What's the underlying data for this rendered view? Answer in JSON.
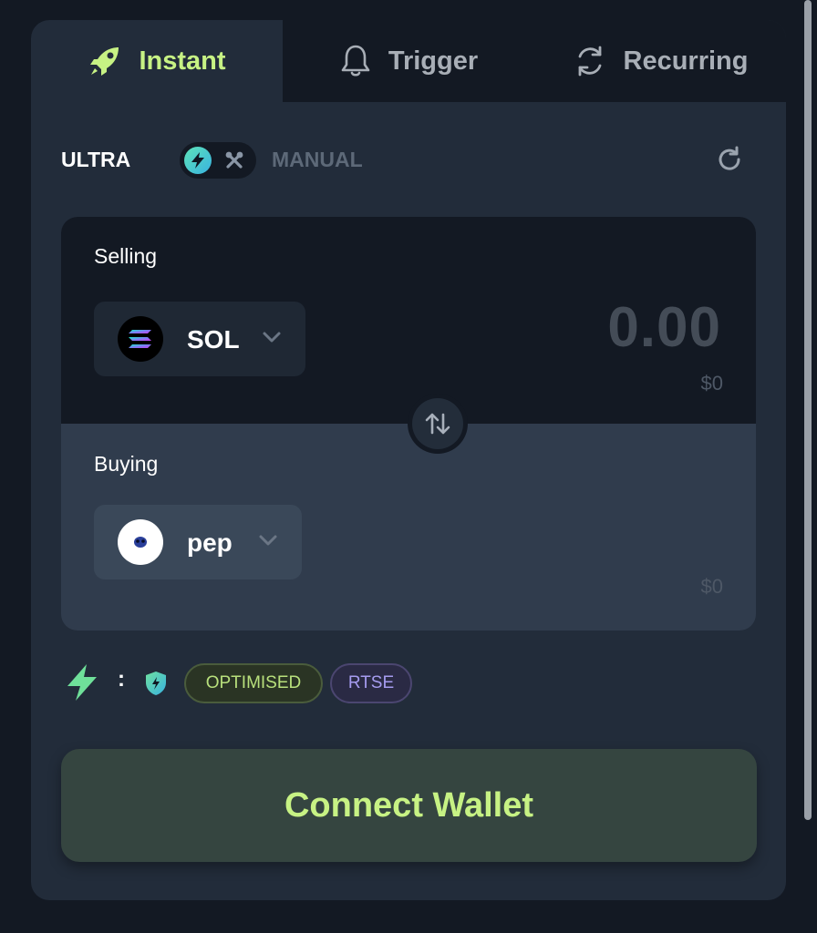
{
  "tabs": [
    {
      "label": "Instant",
      "icon": "rocket-icon",
      "active": true
    },
    {
      "label": "Trigger",
      "icon": "bell-icon",
      "active": false
    },
    {
      "label": "Recurring",
      "icon": "recurring-icon",
      "active": false
    }
  ],
  "mode": {
    "ultra_label": "ULTRA",
    "manual_label": "MANUAL",
    "toggle_on_icon": "lightning-icon",
    "toggle_off_icon": "tools-icon"
  },
  "selling": {
    "label": "Selling",
    "token": "SOL",
    "amount": "0.00",
    "usd": "$0"
  },
  "buying": {
    "label": "Buying",
    "token": "pep",
    "usd": "$0"
  },
  "badges": {
    "separator": ":",
    "optimised": "OPTIMISED",
    "rtse": "RTSE"
  },
  "connect_label": "Connect Wallet",
  "colors": {
    "accent": "#c7f284",
    "card_bg": "#222c3a",
    "page_bg": "#131923",
    "rtse": "#a69cf0"
  }
}
